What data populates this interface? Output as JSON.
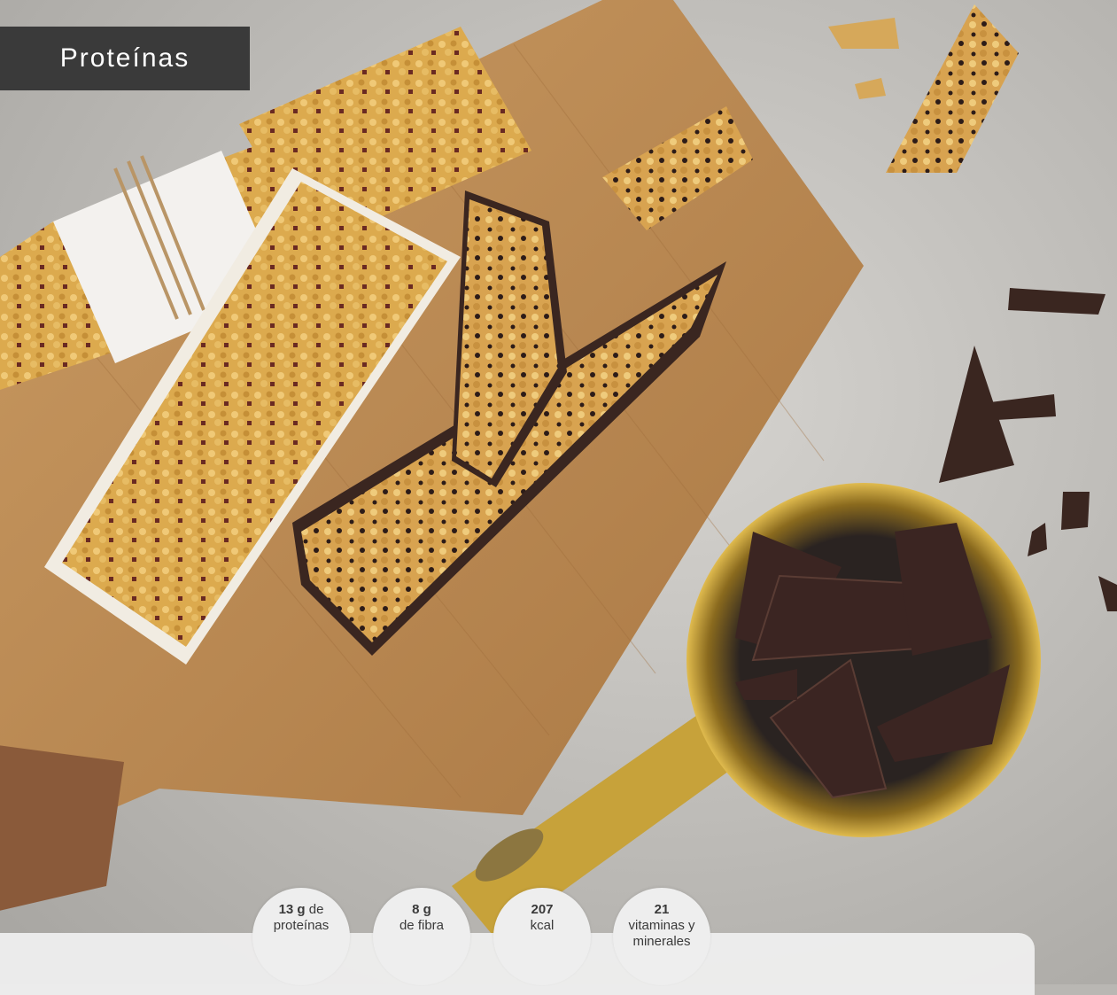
{
  "header": {
    "badge": "Proteínas"
  },
  "stats": [
    {
      "value": "13 g",
      "label_inline": "de",
      "label": "proteínas"
    },
    {
      "value": "8 g",
      "label": "de fibra"
    },
    {
      "value": "207",
      "label": "kcal"
    },
    {
      "value": "21",
      "label": "vitaminas y",
      "label2": "minerales"
    }
  ],
  "colors": {
    "badge_bg": "#3a3a3a",
    "board": "#b98a55",
    "cup_gold": "#c7a23a",
    "chocolate": "#3a2620",
    "bar": "#d9a64a"
  }
}
